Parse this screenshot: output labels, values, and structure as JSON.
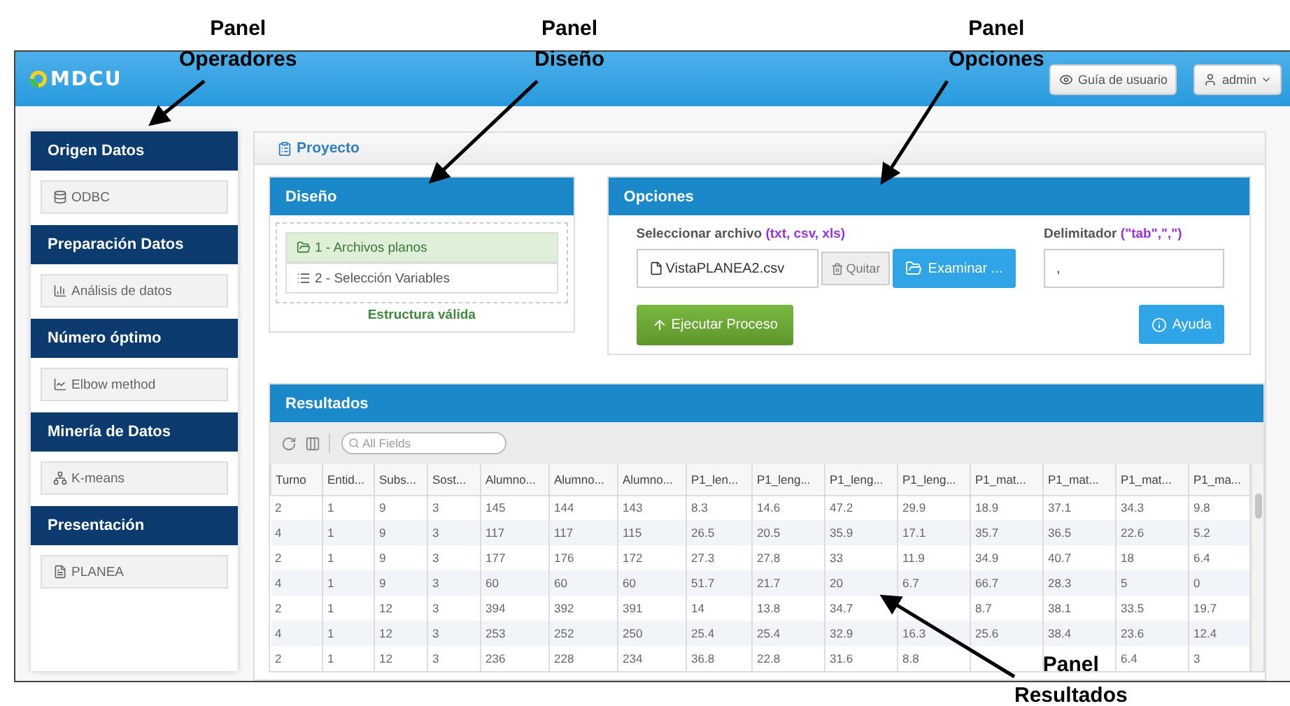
{
  "annotations": [
    {
      "lines": [
        "Panel",
        "Operadores"
      ]
    },
    {
      "lines": [
        "Panel",
        "Diseño"
      ]
    },
    {
      "lines": [
        "Panel",
        "Opciones"
      ]
    },
    {
      "lines": [
        "Panel",
        "Resultados"
      ]
    }
  ],
  "header": {
    "logo": "MDCU",
    "buttons": [
      {
        "kind": "guide",
        "label": "Guía de usuario"
      },
      {
        "kind": "user",
        "label": "admin"
      }
    ]
  },
  "sidebar": {
    "sections": [
      {
        "kind": "database",
        "title": "Origen Datos",
        "item": "ODBC"
      },
      {
        "kind": "bars",
        "title": "Preparación Datos",
        "item": "Análisis de datos"
      },
      {
        "kind": "line",
        "title": "Número óptimo",
        "item": "Elbow method"
      },
      {
        "kind": "network",
        "title": "Minería de Datos",
        "item": "K-means"
      },
      {
        "kind": "file",
        "title": "Presentación",
        "item": "PLANEA"
      }
    ]
  },
  "project": {
    "title": "Proyecto"
  },
  "design": {
    "title": "Diseño",
    "steps": [
      {
        "kind": "folder",
        "label": "1 - Archivos planos",
        "selected": true
      },
      {
        "kind": "list",
        "label": "2 - Selección Variables",
        "selected": false
      }
    ],
    "status": "Estructura válida"
  },
  "options": {
    "title": "Opciones",
    "file_label": "Seleccionar archivo",
    "file_hint": "(txt, csv, xls)",
    "file_name": "VistaPLANEA2.csv",
    "remove": "Quitar",
    "browse": "Examinar ...",
    "delimiter_label": "Delimitador",
    "delimiter_hint": "(\"tab\",\",\")",
    "delimiter_value": ",",
    "run": "Ejecutar Proceso",
    "help": "Ayuda"
  },
  "results": {
    "title": "Resultados",
    "search_placeholder": "All Fields",
    "columns": [
      "Turno",
      "Entid...",
      "Subs...",
      "Sost...",
      "Alumno...",
      "Alumno...",
      "Alumno...",
      "P1_len...",
      "P1_leng...",
      "P1_leng...",
      "P1_leng...",
      "P1_mat...",
      "P1_mat...",
      "P1_mat...",
      "P1_ma..."
    ],
    "rows": [
      [
        "2",
        "1",
        "9",
        "3",
        "145",
        "144",
        "143",
        "8.3",
        "14.6",
        "47.2",
        "29.9",
        "18.9",
        "37.1",
        "34.3",
        "9.8"
      ],
      [
        "4",
        "1",
        "9",
        "3",
        "117",
        "117",
        "115",
        "26.5",
        "20.5",
        "35.9",
        "17.1",
        "35.7",
        "36.5",
        "22.6",
        "5.2"
      ],
      [
        "2",
        "1",
        "9",
        "3",
        "177",
        "176",
        "172",
        "27.3",
        "27.8",
        "33",
        "11.9",
        "34.9",
        "40.7",
        "18",
        "6.4"
      ],
      [
        "4",
        "1",
        "9",
        "3",
        "60",
        "60",
        "60",
        "51.7",
        "21.7",
        "20",
        "6.7",
        "66.7",
        "28.3",
        "5",
        "0"
      ],
      [
        "2",
        "1",
        "12",
        "3",
        "394",
        "392",
        "391",
        "14",
        "13.8",
        "34.7",
        null,
        "8.7",
        "38.1",
        "33.5",
        "19.7"
      ],
      [
        "4",
        "1",
        "12",
        "3",
        "253",
        "252",
        "250",
        "25.4",
        "25.4",
        "32.9",
        "16.3",
        "25.6",
        "38.4",
        "23.6",
        "12.4"
      ],
      [
        "2",
        "1",
        "12",
        "3",
        "236",
        "228",
        "234",
        "36.8",
        "22.8",
        "31.6",
        "8.8",
        null,
        null,
        "6.4",
        "3"
      ]
    ]
  }
}
